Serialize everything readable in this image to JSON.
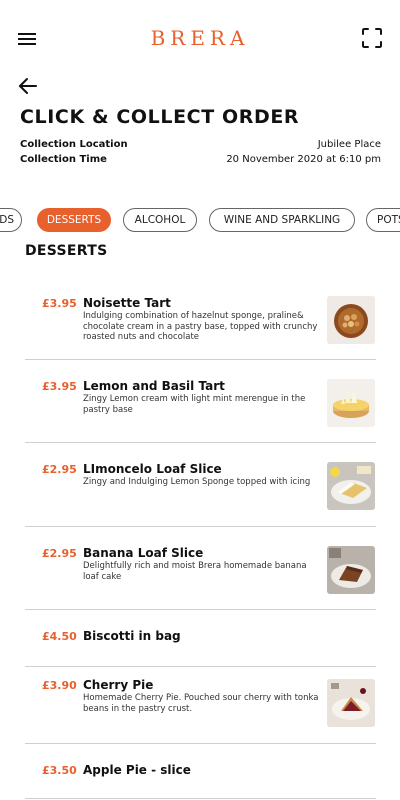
{
  "header": {
    "brand": "BRERA",
    "menu_icon": "hamburger-menu-icon",
    "scan_icon": "scan-frame-icon",
    "back_icon": "back-arrow-icon"
  },
  "page": {
    "title": "CLICK & COLLECT ORDER",
    "collection_location_label": "Collection Location",
    "collection_location_value": "Jubilee Place",
    "collection_time_label": "Collection Time",
    "collection_time_value": "20 November 2020 at 6:10 pm"
  },
  "tabs": [
    {
      "label": "BREADS",
      "active": false
    },
    {
      "label": "DESSERTS",
      "active": true
    },
    {
      "label": "ALCOHOL",
      "active": false
    },
    {
      "label": "WINE AND SPARKLING",
      "active": false
    },
    {
      "label": "POTS",
      "active": false
    }
  ],
  "section": {
    "title": "DESSERTS"
  },
  "items": [
    {
      "price": "£3.95",
      "name": "Noisette Tart",
      "description": "Indulging combination of hazelnut sponge, praline& chocolate cream in a pastry base, topped with crunchy roasted nuts and chocolate",
      "image": "noisette-tart"
    },
    {
      "price": "£3.95",
      "name": "Lemon and Basil Tart",
      "description": "Zingy Lemon cream with light mint merengue in the pastry base",
      "image": "lemon-tart"
    },
    {
      "price": "£2.95",
      "name": "LImoncelo Loaf Slice",
      "description": "Zingy and Indulging Lemon Sponge topped with icing",
      "image": "limoncello-loaf"
    },
    {
      "price": "£2.95",
      "name": "Banana Loaf Slice",
      "description": "Delightfully rich and moist Brera homemade banana loaf cake",
      "image": "banana-loaf"
    },
    {
      "price": "£4.50",
      "name": "Biscotti in bag",
      "description": "",
      "image": ""
    },
    {
      "price": "£3.90",
      "name": "Cherry Pie",
      "description": "Homemade Cherry Pie. Pouched sour cherry with tonka beans in the pastry crust.",
      "image": "cherry-pie"
    },
    {
      "price": "£3.50",
      "name": "Apple Pie - slice",
      "description": "",
      "image": ""
    }
  ],
  "colors": {
    "accent": "#e8602c",
    "text": "#111111",
    "divider": "#d0d0d0"
  }
}
